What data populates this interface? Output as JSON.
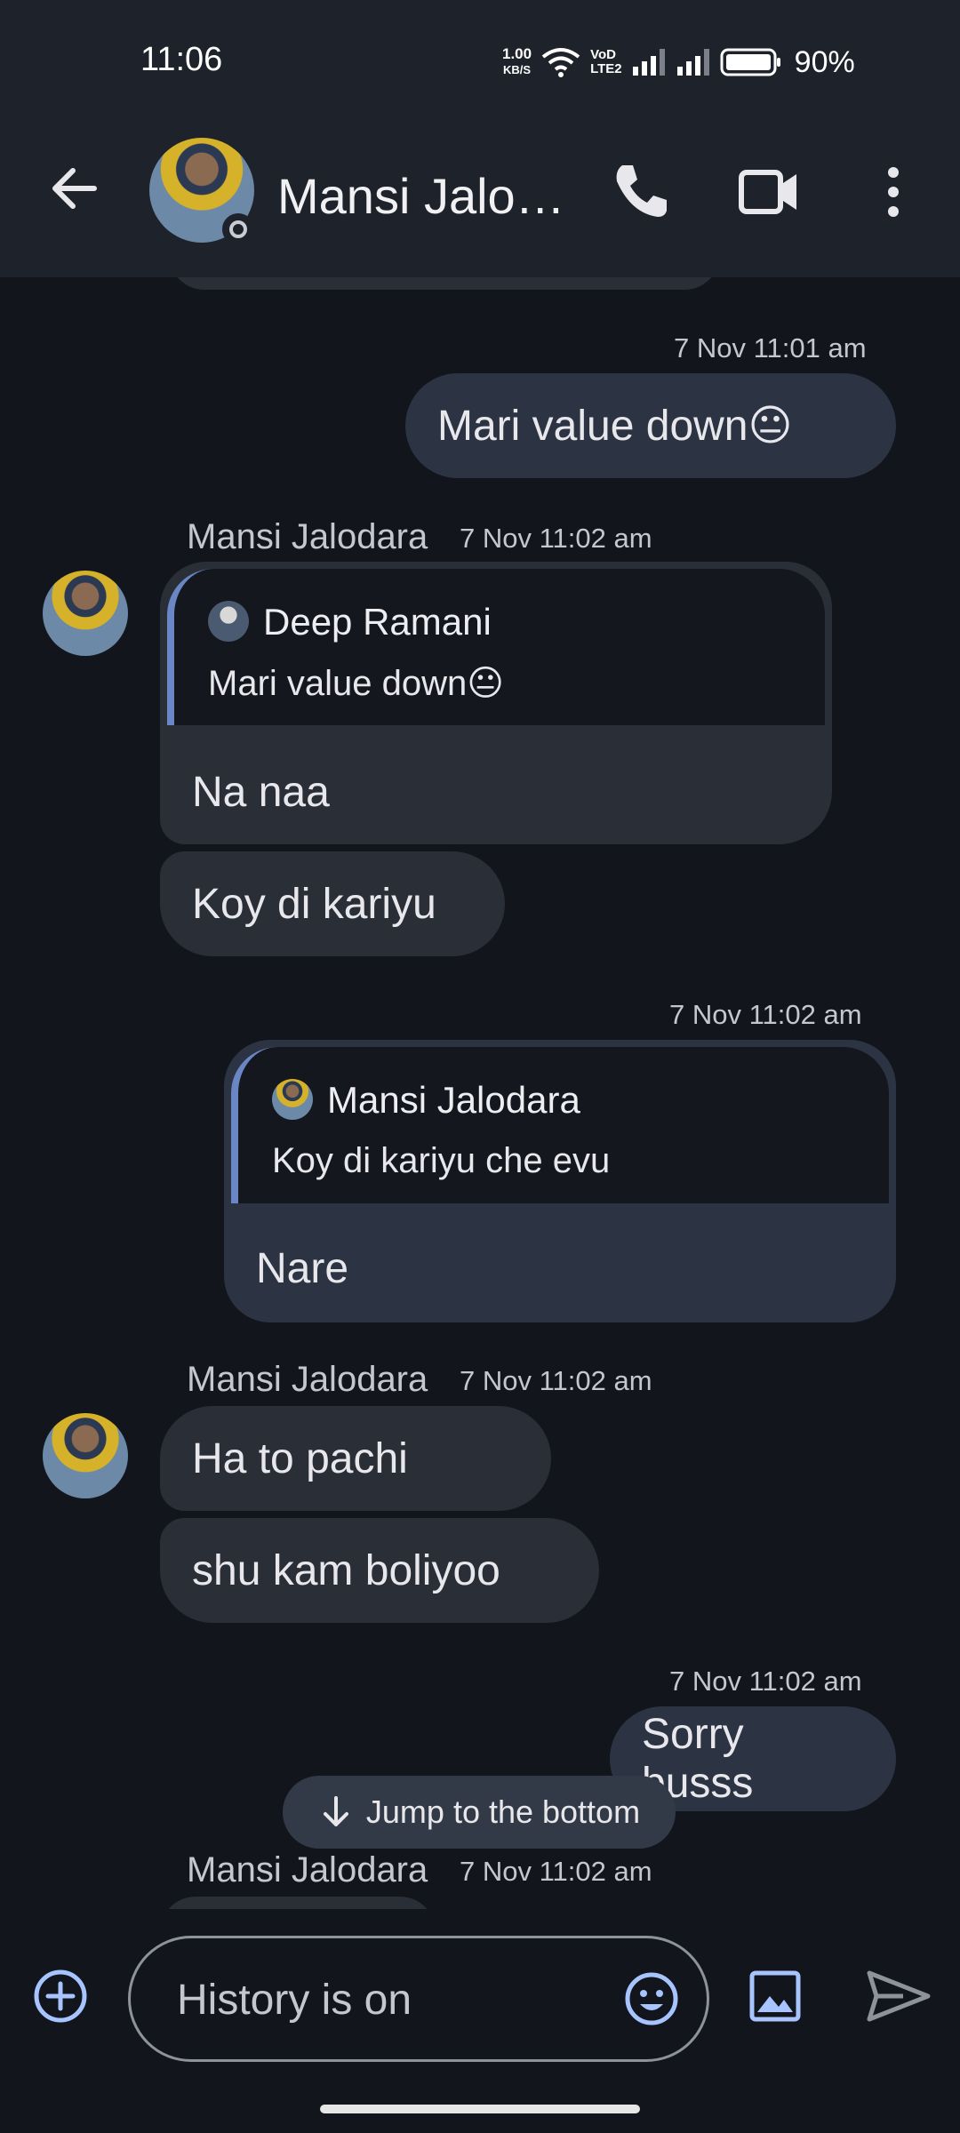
{
  "status_bar": {
    "time": "11:06",
    "net_speed_value": "1.00",
    "net_speed_unit": "KB/S",
    "volte_top": "VoD",
    "volte_bottom": "LTE2",
    "battery_percent": "90%"
  },
  "header": {
    "contact_name": "Mansi Jalo…"
  },
  "messages": [
    {
      "timestamp": "7 Nov 11:01 am",
      "text": "Mari value down😐"
    },
    {
      "sender": "Mansi Jalodara",
      "timestamp": "7 Nov 11:02 am",
      "quote_author": "Deep Ramani",
      "quote_text": "Mari value down😐",
      "text": "Na naa",
      "followup": "Koy di kariyu"
    },
    {
      "timestamp": "7 Nov 11:02 am",
      "quote_author": "Mansi Jalodara",
      "quote_text": "Koy di kariyu che evu",
      "text": "Nare"
    },
    {
      "sender": "Mansi Jalodara",
      "timestamp": "7 Nov 11:02 am",
      "text": "Ha to pachi",
      "followup": "shu kam boliyoo"
    },
    {
      "timestamp": "7 Nov 11:02 am",
      "text": "Sorry busss"
    },
    {
      "sender": "Mansi Jalodara",
      "timestamp": "7 Nov 11:02 am"
    }
  ],
  "jump_button": {
    "label": "Jump to the bottom"
  },
  "composer": {
    "placeholder": "History is on"
  },
  "colors": {
    "accent": "#a8c4ff",
    "background": "#12151b",
    "incoming_bubble": "#2a2e37",
    "outgoing_bubble": "#2c3444"
  }
}
